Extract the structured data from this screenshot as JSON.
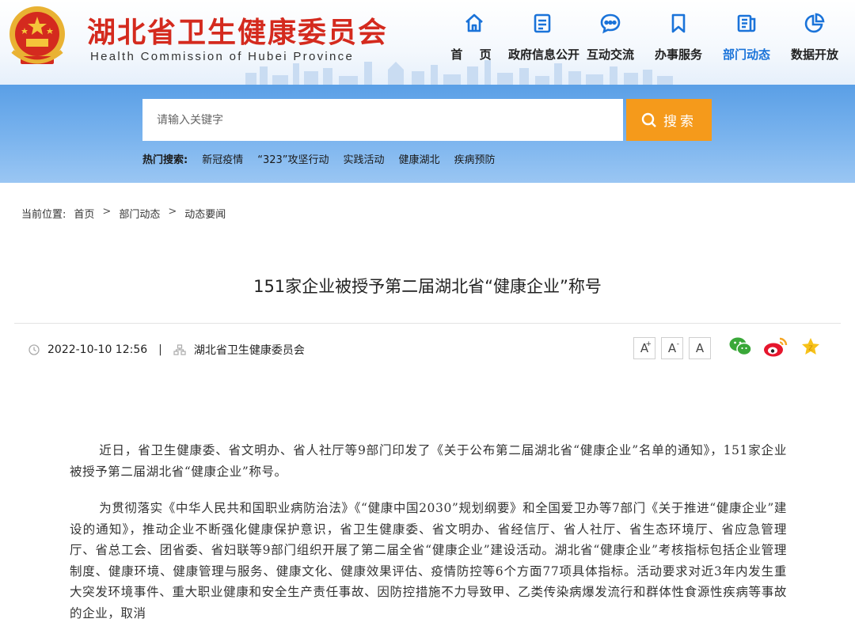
{
  "header": {
    "title": "湖北省卫生健康委员会",
    "subtitle": "Health Commission of Hubei Province"
  },
  "nav": [
    {
      "label": "首 页",
      "icon": "home-icon"
    },
    {
      "label": "政府信息公开",
      "icon": "document-icon"
    },
    {
      "label": "互动交流",
      "icon": "chat-icon"
    },
    {
      "label": "办事服务",
      "icon": "bookmark-icon"
    },
    {
      "label": "部门动态",
      "icon": "news-icon",
      "active": true
    },
    {
      "label": "数据开放",
      "icon": "pie-chart-icon"
    }
  ],
  "search": {
    "placeholder": "请输入关键字",
    "button_label": "搜索",
    "hot_title": "热门搜索:",
    "hot_links": [
      "新冠疫情",
      "“323”攻坚行动",
      "实践活动",
      "健康湖北",
      "疾病预防"
    ]
  },
  "breadcrumb": {
    "prefix": "当前位置:",
    "items": [
      "首页",
      "部门动态",
      "动态要闻"
    ],
    "separator": ">"
  },
  "article": {
    "title": "151家企业被授予第二届湖北省“健康企业”称号",
    "datetime": "2022-10-10 12:56",
    "divider": "|",
    "source": "湖北省卫生健康委员会",
    "paragraphs": [
      "近日，省卫生健康委、省文明办、省人社厅等9部门印发了《关于公布第二届湖北省“健康企业”名单的通知》，151家企业被授予第二届湖北省“健康企业”称号。",
      "为贯彻落实《中华人民共和国职业病防治法》《“健康中国2030”规划纲要》和全国爱卫办等7部门《关于推进“健康企业”建设的通知》，推动企业不断强化健康保护意识，省卫生健康委、省文明办、省经信厅、省人社厅、省生态环境厅、省应急管理厅、省总工会、团省委、省妇联等9部门组织开展了第二届全省“健康企业”建设活动。湖北省“健康企业”考核指标包括企业管理制度、健康环境、健康管理与服务、健康文化、健康效果评估、疫情防控等6个方面77项具体指标。活动要求对近3年内发生重大突发环境事件、重大职业健康和安全生产责任事故、因防控措施不力导致甲、乙类传染病爆发流行和群体性食源性疾病等事故的企业，取消"
    ]
  },
  "font_tools": [
    {
      "label": "A",
      "sup": "+"
    },
    {
      "label": "A",
      "sup": "-"
    },
    {
      "label": "A",
      "sup": ""
    }
  ],
  "colors": {
    "brand_red": "#d42a1e",
    "accent_blue": "#1a73d9",
    "search_orange": "#f59a1b"
  }
}
